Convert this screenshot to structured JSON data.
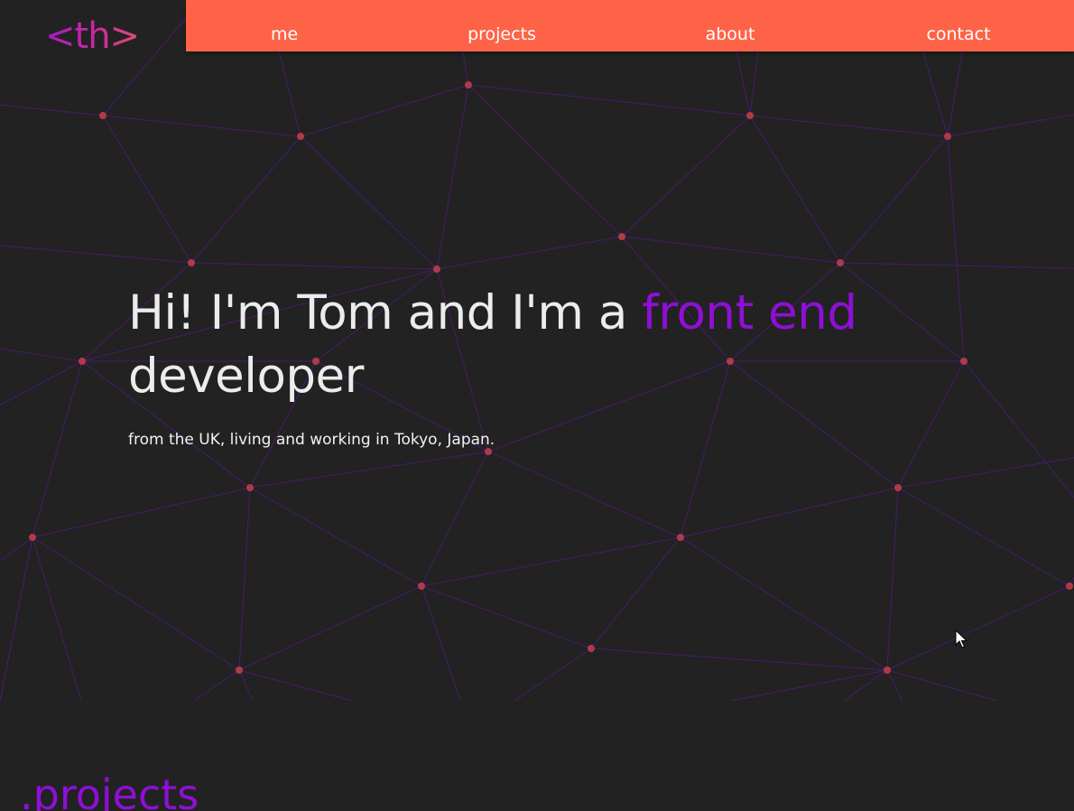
{
  "logo": {
    "text": "<th>"
  },
  "nav": {
    "items": [
      {
        "label": "me"
      },
      {
        "label": "projects"
      },
      {
        "label": "about"
      },
      {
        "label": "contact"
      }
    ]
  },
  "hero": {
    "title_part1": "Hi! I'm Tom and I'm a",
    "title_accent": "front end",
    "title_part2": "developer",
    "subtitle": "from the UK, living and working in Tokyo, Japan."
  },
  "sections": {
    "projects_heading": ".projects"
  },
  "colors": {
    "background": "#222222",
    "navbar": "#ff6347",
    "accent_purple": "#8e0fd6",
    "network_line": "#4a1a6e",
    "network_node": "#b03a4a",
    "hero_text": "#ececec"
  },
  "icons": {
    "cursor": "mouse-pointer-icon"
  }
}
